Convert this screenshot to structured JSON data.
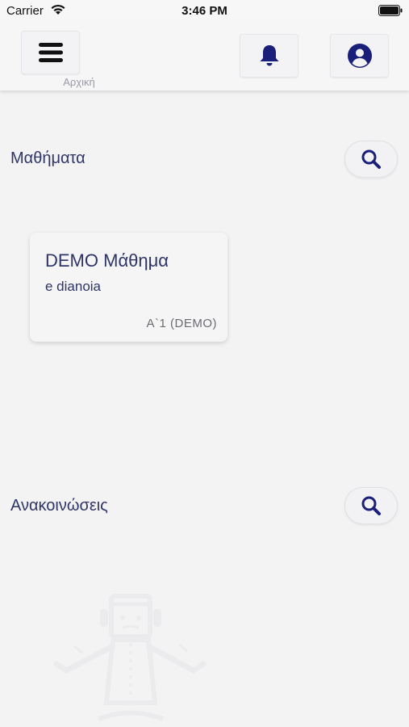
{
  "status_bar": {
    "carrier": "Carrier",
    "time": "3:46 PM"
  },
  "header": {
    "home_label": "Αρχική",
    "menu_icon": "hamburger-icon",
    "bell_icon": "bell-icon",
    "account_icon": "account-circle-icon"
  },
  "courses": {
    "title": "Μαθήματα",
    "items": [
      {
        "title": "DEMO Μάθημα",
        "subtitle": "e dianoia",
        "class": "A`1 (DEMO)"
      }
    ]
  },
  "announcements": {
    "title": "Ανακοινώσεις"
  },
  "colors": {
    "accent": "#1a1f7a",
    "background": "#f4f3f4",
    "text": "#2f3566"
  }
}
